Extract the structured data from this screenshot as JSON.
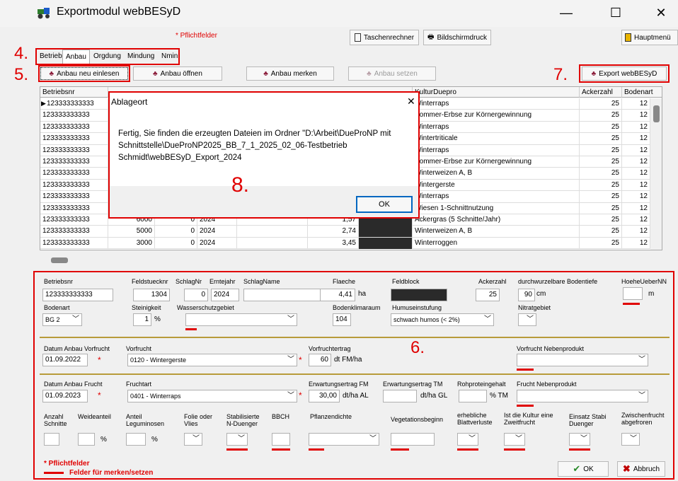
{
  "window": {
    "title": "Exportmodul webBESyD",
    "minimize": "—",
    "maximize": "☐",
    "close": "✕"
  },
  "toolbar": {
    "pflichtfelder": "* Pflichtfelder",
    "taschenrechner": "Taschenrechner",
    "bildschirmdruck": "Bildschirmdruck",
    "hauptmenu": "Hauptmenü"
  },
  "callouts": {
    "c4": "4.",
    "c5": "5.",
    "c6": "6.",
    "c7": "7.",
    "c8": "8."
  },
  "tabs": [
    "Betrieb",
    "Anbau",
    "Orgdung",
    "Mindung",
    "Nmin"
  ],
  "actions": {
    "neu_einlesen": "Anbau neu einlesen",
    "oeffnen": "Anbau öffnen",
    "merken": "Anbau merken",
    "setzen": "Anbau setzen",
    "export": "Export webBESyD"
  },
  "grid": {
    "headers": {
      "betriebsnr": "Betriebsnr",
      "kultur": "KulturDuepro",
      "ackerzahl": "Ackerzahl",
      "bodenart": "Bodenart"
    },
    "rows": [
      {
        "betriebsnr": "123333333333",
        "c2": "",
        "c3": "",
        "c4": "",
        "flaeche": "",
        "kultur": "Winterraps",
        "ackerzahl": "25",
        "bodenart": "12"
      },
      {
        "betriebsnr": "123333333333",
        "c2": "",
        "c3": "",
        "c4": "",
        "flaeche": "",
        "kultur": "Sommer-Erbse zur Körnergewinnung",
        "ackerzahl": "25",
        "bodenart": "12"
      },
      {
        "betriebsnr": "123333333333",
        "c2": "",
        "c3": "",
        "c4": "",
        "flaeche": "",
        "kultur": "Winterraps",
        "ackerzahl": "25",
        "bodenart": "12"
      },
      {
        "betriebsnr": "123333333333",
        "c2": "",
        "c3": "",
        "c4": "",
        "flaeche": "",
        "kultur": "Wintertriticale",
        "ackerzahl": "25",
        "bodenart": "12"
      },
      {
        "betriebsnr": "123333333333",
        "c2": "",
        "c3": "",
        "c4": "",
        "flaeche": "",
        "kultur": "Winterraps",
        "ackerzahl": "25",
        "bodenart": "12"
      },
      {
        "betriebsnr": "123333333333",
        "c2": "",
        "c3": "",
        "c4": "",
        "flaeche": "",
        "kultur": "Sommer-Erbse zur Körnergewinnung",
        "ackerzahl": "25",
        "bodenart": "12"
      },
      {
        "betriebsnr": "123333333333",
        "c2": "",
        "c3": "",
        "c4": "",
        "flaeche": "",
        "kultur": "Winterweizen A, B",
        "ackerzahl": "25",
        "bodenart": "12"
      },
      {
        "betriebsnr": "123333333333",
        "c2": "",
        "c3": "",
        "c4": "",
        "flaeche": "",
        "kultur": "Wintergerste",
        "ackerzahl": "25",
        "bodenart": "12"
      },
      {
        "betriebsnr": "123333333333",
        "c2": "",
        "c3": "",
        "c4": "",
        "flaeche": "",
        "kultur": "Winterraps",
        "ackerzahl": "25",
        "bodenart": "12"
      },
      {
        "betriebsnr": "123333333333",
        "c2": "",
        "c3": "",
        "c4": "",
        "flaeche": "",
        "kultur": "Wiesen 1-Schnittnutzung",
        "ackerzahl": "25",
        "bodenart": "12"
      },
      {
        "betriebsnr": "123333333333",
        "c2": "6000",
        "c3": "0",
        "c4": "2024",
        "flaeche": "1,57",
        "kultur": "Ackergras (5 Schnitte/Jahr)",
        "ackerzahl": "25",
        "bodenart": "12"
      },
      {
        "betriebsnr": "123333333333",
        "c2": "5000",
        "c3": "0",
        "c4": "2024",
        "flaeche": "2,74",
        "kultur": "Winterweizen A, B",
        "ackerzahl": "25",
        "bodenart": "12"
      },
      {
        "betriebsnr": "123333333333",
        "c2": "3000",
        "c3": "0",
        "c4": "2024",
        "flaeche": "3,45",
        "kultur": "Winterroggen",
        "ackerzahl": "25",
        "bodenart": "12"
      }
    ]
  },
  "dialog": {
    "title": "Ablageort",
    "close": "✕",
    "message": "Fertig, Sie finden die erzeugten Dateien im Ordner \"D:\\Arbeit\\DueProNP mit Schnittstelle\\DueProNP2025_BB_7_1_2025_02_06-Testbetrieb Schmidt\\webBESyD_Export_2024",
    "ok": "OK"
  },
  "form": {
    "labels": {
      "betriebsnr": "Betriebsnr",
      "feldstuecknr": "Feldstuecknr",
      "schlagnr": "SchlagNr",
      "erntejahr": "Erntejahr",
      "schlagname": "SchlagName",
      "flaeche": "Flaeche",
      "feldblock": "Feldblock",
      "ackerzahl": "Ackerzahl",
      "bodentiefe": "durchwurzelbare Bodentiefe",
      "hoehe": "HoeheUeberNN",
      "bodenart": "Bodenart",
      "steinigkeit": "Steinigkeit",
      "wasserschutz": "Wasserschutzgebiet",
      "bodenklima": "Bodenklimaraum",
      "humus": "Humuseinstufung",
      "nitrat": "Nitratgebiet",
      "datum_vorfrucht": "Datum Anbau Vorfrucht",
      "vorfrucht": "Vorfrucht",
      "vorfruchtertrag": "Vorfruchtertrag",
      "vorfrucht_neben": "Vorfrucht Nebenprodukt",
      "datum_frucht": "Datum Anbau Frucht",
      "fruchtart": "Fruchtart",
      "ertrag_fm": "Erwartungsertrag FM",
      "ertrag_tm": "Erwartungsertrag TM",
      "rohprotein": "Rohproteingehalt",
      "frucht_neben": "Frucht Nebenprodukt",
      "anzahl_schnitte": "Anzahl Schnitte",
      "weideanteil": "Weideanteil",
      "leguminosen": "Anteil Leguminosen",
      "folie": "Folie oder Vlies",
      "stabi_n": "Stabilisierte N-Duenger",
      "bbch": "BBCH",
      "pflanzendichte": "Pflanzendichte",
      "vegetationsbeginn": "Vegetationsbeginn",
      "blattverluste": "erhebliche Blattverluste",
      "zweitfrucht": "Ist die Kultur eine Zweitfrucht",
      "einsatz_stabi": "Einsatz Stabi Duenger",
      "zwischenfrucht": "Zwischenfrucht abgefroren"
    },
    "units": {
      "ha": "ha",
      "cm": "cm",
      "m": "m",
      "pct": "%",
      "dt_fm_ha": "dt FM/ha",
      "dt_ha_al": "dt/ha AL",
      "dt_ha_gl": "dt/ha GL",
      "pct_tm": "% TM"
    },
    "values": {
      "betriebsnr": "123333333333",
      "feldstuecknr": "1304",
      "schlagnr": "0",
      "erntejahr": "2024",
      "schlagname": "",
      "flaeche": "4,41",
      "ackerzahl": "25",
      "bodentiefe": "90",
      "hoehe": "",
      "bodenart": "BG 2",
      "steinigkeit": "1",
      "wasserschutz": "",
      "bodenklima": "104",
      "humus": "schwach humos (< 2%)",
      "nitrat": "",
      "datum_vorfrucht": "01.09.2022",
      "vorfrucht": "0120 - Wintergerste",
      "vorfruchtertrag": "60",
      "vorfrucht_neben": "",
      "datum_frucht": "01.09.2023",
      "fruchtart": "0401 - Winterraps",
      "ertrag_fm": "30,00",
      "ertrag_tm": "",
      "rohprotein": "",
      "frucht_neben": ""
    },
    "star": "*",
    "legend_pflicht": "* Pflichtfelder",
    "legend_merken": "Felder für merken/setzen",
    "ok": "OK",
    "abbruch": "Abbruch"
  }
}
